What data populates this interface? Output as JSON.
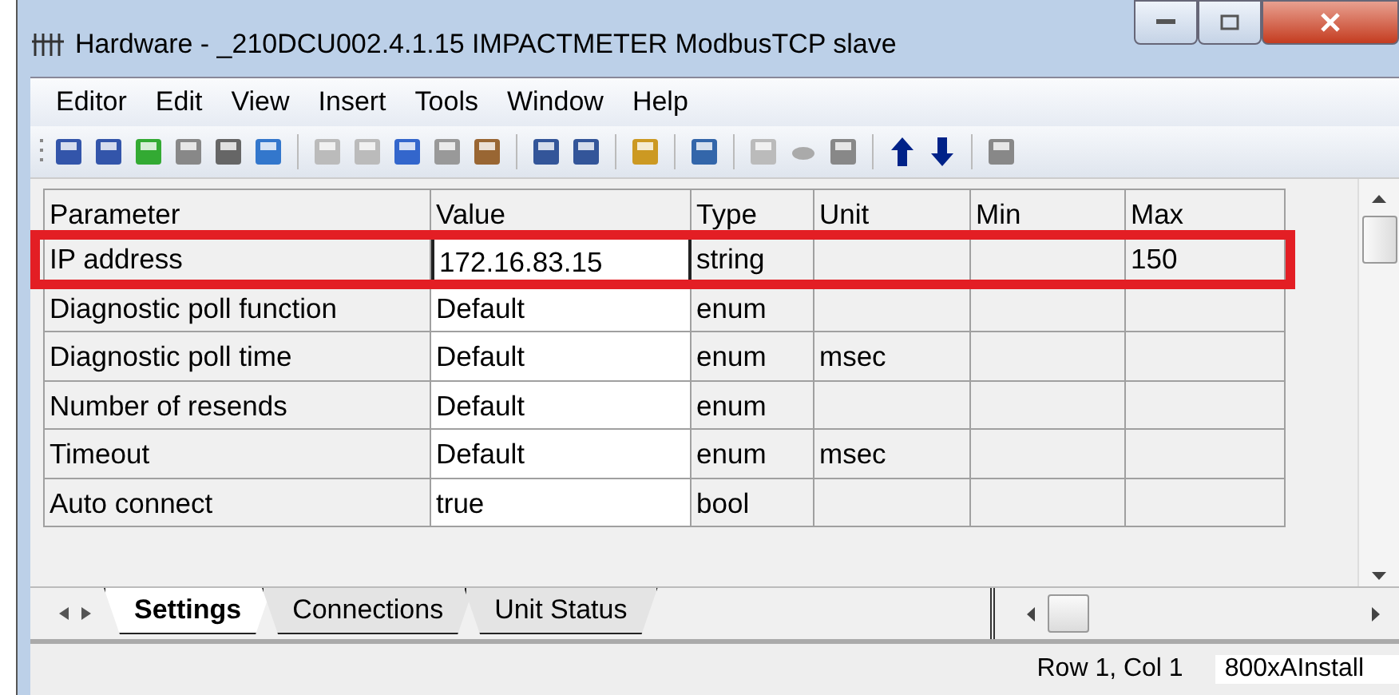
{
  "window": {
    "title": "Hardware - _210DCU002.4.1.15  IMPACTMETER  ModbusTCP slave"
  },
  "menu": [
    "Editor",
    "Edit",
    "View",
    "Insert",
    "Tools",
    "Window",
    "Help"
  ],
  "table": {
    "columns": [
      "Parameter",
      "Value",
      "Type",
      "Unit",
      "Min",
      "Max"
    ],
    "rows": [
      {
        "cells": [
          "IP address",
          "172.16.83.15",
          "string",
          "",
          "",
          "150"
        ],
        "selected": true
      },
      {
        "cells": [
          "Diagnostic poll function",
          "Default",
          "enum",
          "",
          "",
          ""
        ],
        "selected": false
      },
      {
        "cells": [
          "Diagnostic poll time",
          "Default",
          "enum",
          "msec",
          "",
          ""
        ],
        "selected": false
      },
      {
        "cells": [
          "Number of resends",
          "Default",
          "enum",
          "",
          "",
          ""
        ],
        "selected": false
      },
      {
        "cells": [
          "Timeout",
          "Default",
          "enum",
          "msec",
          "",
          ""
        ],
        "selected": false
      },
      {
        "cells": [
          "Auto connect",
          "true",
          "bool",
          "",
          "",
          ""
        ],
        "selected": false
      }
    ]
  },
  "tabs": [
    {
      "label": "Settings",
      "selected": true
    },
    {
      "label": "Connections",
      "selected": false
    },
    {
      "label": "Unit Status",
      "selected": false
    }
  ],
  "status_bar": [
    "Row 1, Col 1",
    "800xAInstall"
  ]
}
